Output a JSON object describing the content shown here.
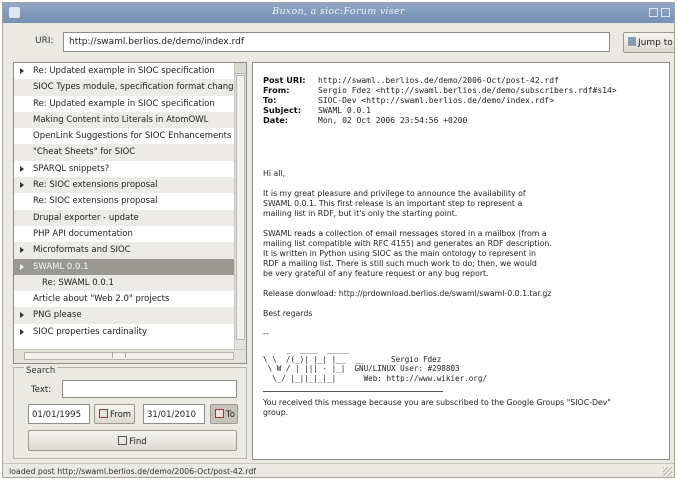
{
  "window": {
    "title": "Buxon, a sioc:Forum viser"
  },
  "url_bar": {
    "label": "URI:",
    "value": "http://swaml.berlios.de/demo/index.rdf",
    "button": "Jump to"
  },
  "threads": [
    {
      "title": "Re: Updated example in SIOC specification",
      "expander": true
    },
    {
      "title": "SIOC Types module, specification format change"
    },
    {
      "title": "Re: Updated example in SIOC specification"
    },
    {
      "title": "Making Content into Literals in AtomOWL"
    },
    {
      "title": "OpenLink Suggestions for SIOC Enhancements and..."
    },
    {
      "title": "\"Cheat Sheets\" for SIOC"
    },
    {
      "title": "SPARQL snippets?",
      "expander": true
    },
    {
      "title": "Re: SIOC extensions proposal",
      "expander": true
    },
    {
      "title": "Re: SIOC extensions proposal"
    },
    {
      "title": "Drupal exporter - update"
    },
    {
      "title": "PHP API documentation"
    },
    {
      "title": "Microformats and SIOC",
      "expander": true
    },
    {
      "title": "SWAML 0.0.1",
      "expander": true,
      "selected": true
    },
    {
      "title": "Re: SWAML 0.0.1",
      "child": true
    },
    {
      "title": "Article about \"Web 2.0\" projects"
    },
    {
      "title": "PNG please",
      "expander": true
    },
    {
      "title": "SIOC properties cardinality",
      "expander": true
    }
  ],
  "search": {
    "legend": "Search",
    "text_label": "Text:",
    "text_value": "",
    "from_date": "01/01/1995",
    "from_button": "From",
    "to_date": "31/01/2010",
    "to_button": "To",
    "find_button": "Find"
  },
  "message": {
    "headers": [
      {
        "key": "Post URI:",
        "value": "http://swaml..berlios.de/demo/2006-Oct/post-42.rdf"
      },
      {
        "key": "From:",
        "value": "Sergio Fdez <http://swaml.berlios.de/demo/subscribers.rdf#s14>"
      },
      {
        "key": "To:",
        "value": "SIOC-Dev <http://swaml.berlios.de/demo/index.rdf>"
      },
      {
        "key": "Subject:",
        "value": "SWAML 0.0.1"
      },
      {
        "key": "Date:",
        "value": "Mon, 02 Oct 2006 23:54:56 +0200"
      }
    ],
    "greeting": "Hi all,",
    "para1": [
      "It is my great pleasure and privilege to announce the availability of",
      "SWAML 0.0.1. This first release is an important step to represent a",
      "mailing list in RDF, but it's only the starting point."
    ],
    "para2": [
      "SWAML reads a collection of email messages stored in a mailbox (from a",
      "mailing list compatible with RFC 4155) and generates an RDF description.",
      "It is written in Python using SIOC as the main ontology to represent in",
      "RDF a mailing list. There is still such much work to do; then, we would",
      "be very grateful of any feature request or any bug report."
    ],
    "download": "Release donwload: http://prdownload.berlios.de/swaml/swaml-0.0.1.tar.gz",
    "regards": "Best regards",
    "sig_dash": "--",
    "signature": [
      "     _  ____  _____",
      "\\ \\  /(_)| |_| |__  __      Sergio Fdez",
      " \\ W / | ||| - |_|  GNU/LINUX User: #298803",
      "  \\_/ |_||_|_|_|      Web: http://www.wikier.org/"
    ],
    "footer": [
      "You received this message because you are subscribed to the Google Groups \"SIOC-Dev\"",
      "group."
    ]
  },
  "status_bar": "loaded post http://swaml.berlios.de/demo/2006-Oct/post-42.rdf"
}
